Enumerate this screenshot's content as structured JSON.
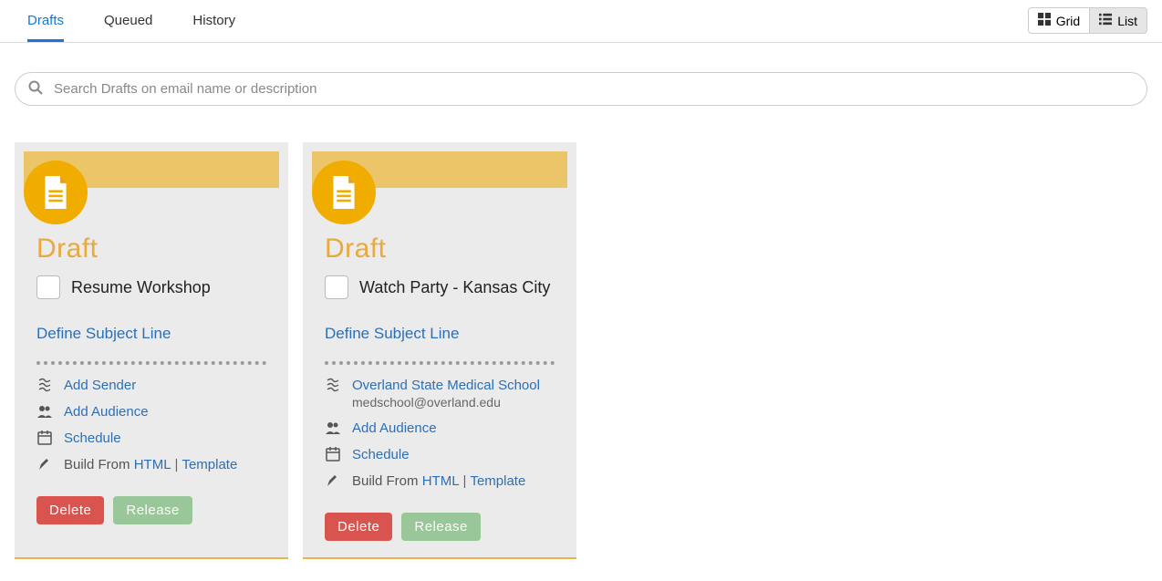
{
  "tabs": {
    "drafts": "Drafts",
    "queued": "Queued",
    "history": "History"
  },
  "view": {
    "grid": "Grid",
    "list": "List"
  },
  "search": {
    "placeholder": "Search Drafts on email name or description"
  },
  "labels": {
    "status": "Draft",
    "define_subject": "Define Subject Line",
    "add_sender": "Add Sender",
    "add_audience": "Add Audience",
    "schedule": "Schedule",
    "build_from": "Build From",
    "html": "HTML",
    "template": "Template",
    "delete": "Delete",
    "release": "Release"
  },
  "cards": [
    {
      "title": "Resume Workshop",
      "sender_name": null,
      "sender_email": null
    },
    {
      "title": "Watch Party - Kansas City",
      "sender_name": "Overland State Medical School",
      "sender_email": "medschool@overland.edu"
    }
  ]
}
